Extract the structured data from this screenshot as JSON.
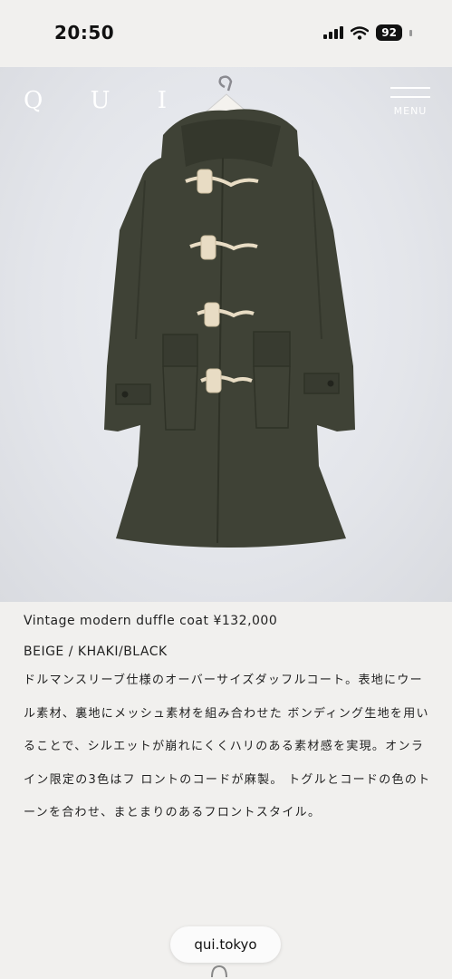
{
  "status": {
    "time": "20:50",
    "battery": "92"
  },
  "header": {
    "logo": "Q U I",
    "menu_label": "MENU"
  },
  "product": {
    "title": "Vintage modern duffle coat ¥132,000",
    "colors": "BEIGE / KHAKI/BLACK",
    "description": "ドルマンスリーブ仕様のオーバーサイズダッフルコート。表地にウール素材、裏地にメッシュ素材を組み合わせた ボンディング生地を用いることで、シルエットが崩れにくくハリのある素材感を実現。オンライン限定の3色はフ ロントのコードが麻製。 トグルとコードの色のトーンを合わせ、まとまりのあるフロントスタイル。"
  },
  "browser": {
    "url": "qui.tokyo"
  },
  "colors": {
    "coat": "#3f4236",
    "background": "#f1f0ee",
    "toggle": "#e8dcc4"
  }
}
